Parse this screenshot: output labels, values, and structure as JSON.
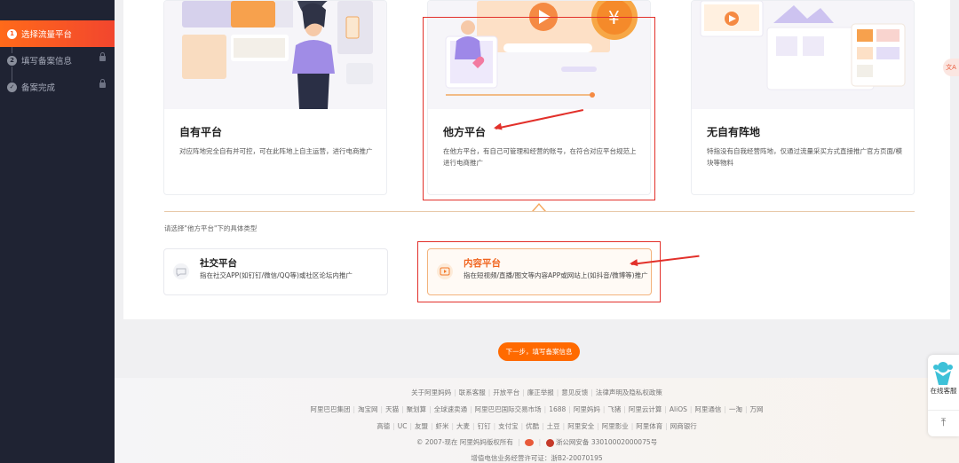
{
  "sidebar": {
    "steps": [
      {
        "num": "1",
        "label": "选择流量平台",
        "active": true
      },
      {
        "num": "2",
        "label": "填写备案信息",
        "active": false
      },
      {
        "num": "✓",
        "label": "备案完成",
        "active": false
      }
    ]
  },
  "cards": [
    {
      "title": "自有平台",
      "desc": "对应阵地完全自有并可控，可在此阵地上自主运营，进行电商推广"
    },
    {
      "title": "他方平台",
      "desc": "在他方平台，有自己可管理和经营的账号，在符合对应平台规范上进行电商推广"
    },
    {
      "title": "无自有阵地",
      "desc": "特指没有自我经营阵地，仅通过流量采买方式直接推广官方页面/模块等物料"
    }
  ],
  "hint": "请选择\"他方平台\"下的具体类型",
  "subtypes": [
    {
      "title": "社交平台",
      "desc": "指在社交APP(如钉钉/微信/QQ等)或社区论坛内推广"
    },
    {
      "title": "内容平台",
      "desc": "指在短视频/直播/图文等内容APP或网站上(如抖音/微博等)推广"
    }
  ],
  "next_button": "下一步，填写备案信息",
  "footer": {
    "row1": [
      "关于阿里妈妈",
      "联系客服",
      "开放平台",
      "廉正举报",
      "意见反馈",
      "法律声明及隐私权政策"
    ],
    "row2": [
      "阿里巴巴集团",
      "淘宝网",
      "天猫",
      "聚划算",
      "全球速卖通",
      "阿里巴巴国际交易市场",
      "1688",
      "阿里妈妈",
      "飞猪",
      "阿里云计算",
      "AliOS",
      "阿里通信",
      "一淘",
      "万网"
    ],
    "row3": [
      "高德",
      "UC",
      "友盟",
      "虾米",
      "大麦",
      "钉钉",
      "支付宝",
      "优酷",
      "土豆",
      "阿里安全",
      "阿里影业",
      "阿里体育",
      "网商银行"
    ],
    "copyright": "© 2007-现在 阿里妈妈版权所有",
    "police": "浙公网安备 33010002000075号",
    "icp": "增值电信业务经营许可证：浙B2-20070195"
  },
  "service": {
    "label": "在线客服",
    "top_icon": "arrow-up-icon"
  },
  "translate_icon": "文A",
  "colors": {
    "accent": "#ff6a00",
    "sidebar": "#1f2333",
    "highlight": "#e2302a"
  }
}
